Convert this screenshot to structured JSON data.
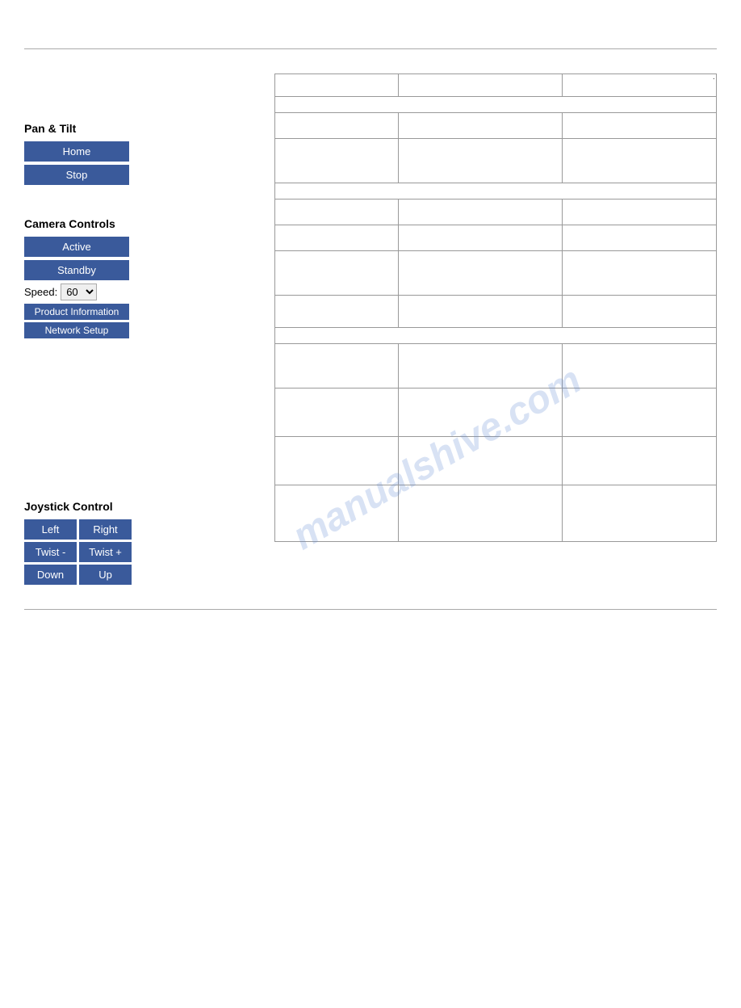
{
  "page": {
    "dot": "·"
  },
  "left": {
    "pan_tilt_title": "Pan & Tilt",
    "home_btn": "Home",
    "stop_btn": "Stop",
    "camera_title": "Camera Controls",
    "active_btn": "Active",
    "standby_btn": "Standby",
    "speed_label": "Speed:",
    "speed_value": "60",
    "product_info_btn": "Product Information",
    "network_setup_btn": "Network Setup",
    "joystick_title": "Joystick Control",
    "left_btn": "Left",
    "right_btn": "Right",
    "twist_minus_btn": "Twist -",
    "twist_plus_btn": "Twist +",
    "down_btn": "Down",
    "up_btn": "Up"
  },
  "watermark": {
    "text": "manualshive.com"
  },
  "table": {
    "rows": 14,
    "cols": 3
  }
}
